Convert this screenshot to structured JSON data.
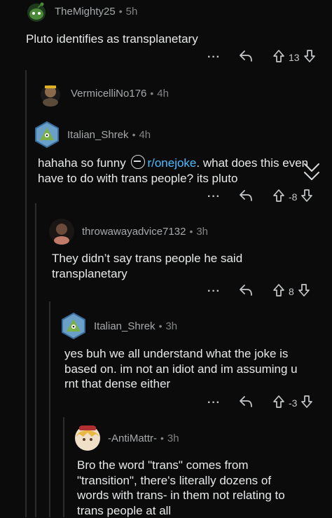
{
  "comments": [
    {
      "username": "TheMighty25",
      "time": "5h",
      "lines": [
        "Pluto identifies as transplanetary"
      ],
      "score": "13"
    },
    {
      "username": "VermicelliNo176",
      "time": "4h"
    },
    {
      "username": "Italian_Shrek",
      "time": "4h",
      "text_a": "hahaha so funny",
      "link": "r/onejoke",
      "text_b": ". what does this even",
      "line2": "have to do with trans people? its pluto",
      "score": "-8"
    },
    {
      "username": "throwawayadvice7132",
      "time": "3h",
      "lines": [
        "They didn’t say trans people he said",
        "transplanetary"
      ],
      "score": "8"
    },
    {
      "username": "Italian_Shrek",
      "time": "3h",
      "lines": [
        "yes buh we all understand what the joke is",
        "based on. im not an idiot and im assuming u",
        "rnt that dense either"
      ],
      "score": "-3"
    },
    {
      "username": "-AntiMattr-",
      "time": "3h",
      "lines": [
        "Bro the word \"trans\" comes from",
        "\"transition\", there's literally dozens of",
        "words with trans- in them not relating to",
        "trans people at all"
      ]
    }
  ],
  "ui": {
    "dot": "•",
    "more": "···"
  },
  "icons": {
    "reply": "reply-arrow-icon",
    "upvote": "upvote-arrow-icon",
    "downvote": "downvote-arrow-icon",
    "collapse": "collapse-chevron-icon"
  }
}
